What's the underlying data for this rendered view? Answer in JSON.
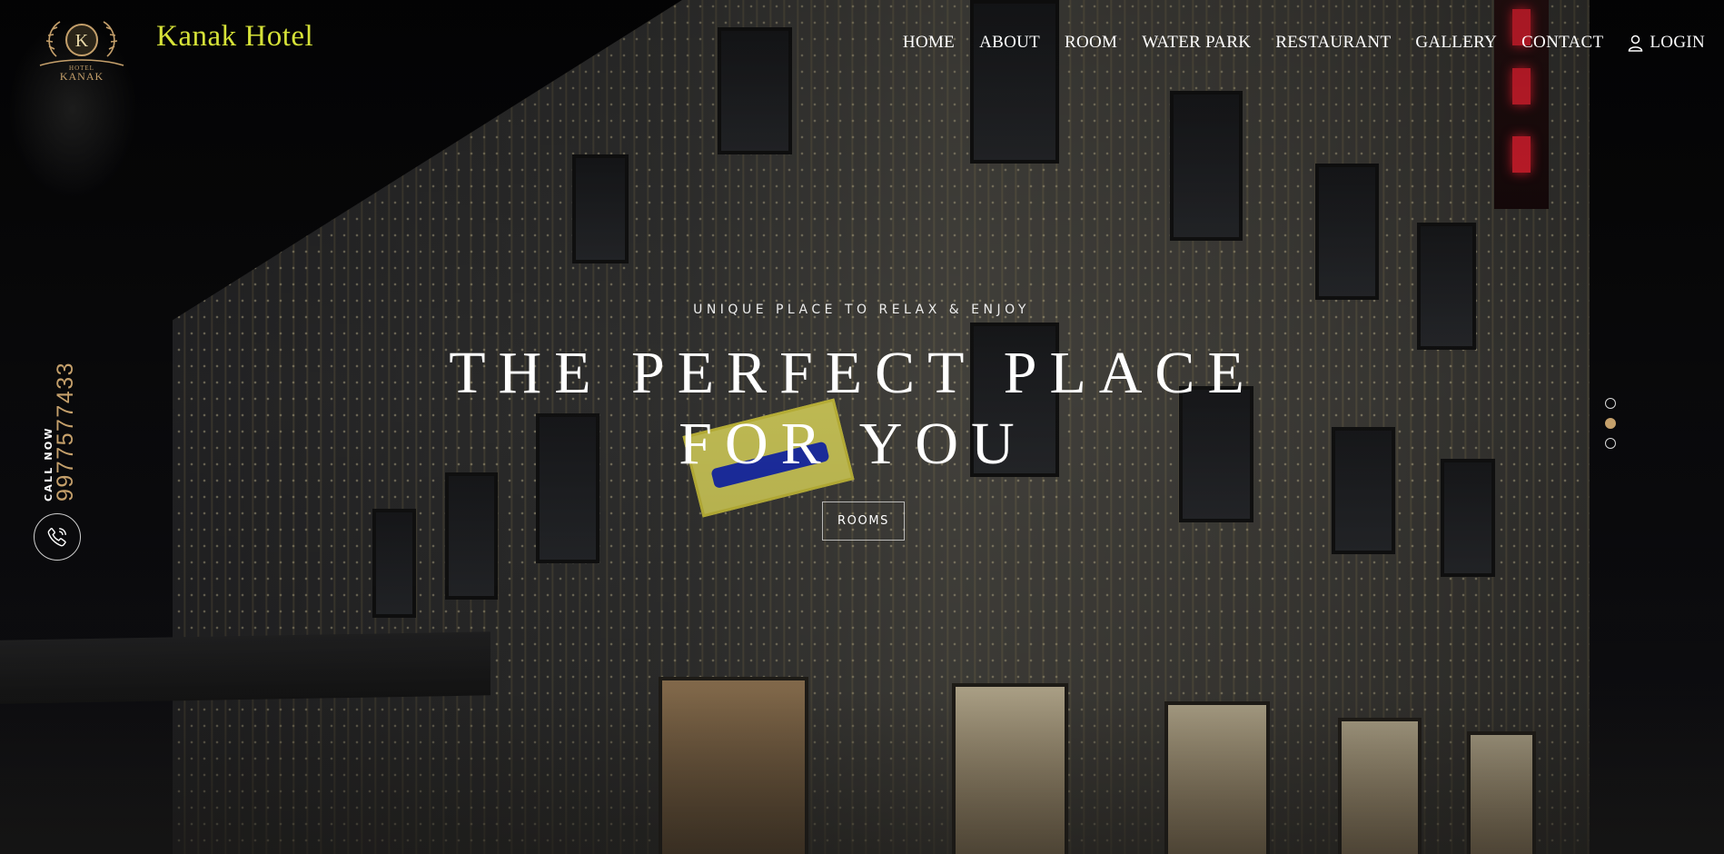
{
  "header": {
    "brand_name": "Kanak Hotel",
    "logo": {
      "letter": "K",
      "text_top": "HOTEL",
      "text_bottom": "KANAK"
    }
  },
  "nav": {
    "items": [
      {
        "label": "HOME"
      },
      {
        "label": "ABOUT"
      },
      {
        "label": "ROOM"
      },
      {
        "label": "WATER PARK"
      },
      {
        "label": "RESTAURANT"
      },
      {
        "label": "GALLERY"
      },
      {
        "label": "CONTACT"
      },
      {
        "label": "LOGIN",
        "icon": "user-icon"
      }
    ]
  },
  "hero": {
    "eyebrow": "UNIQUE PLACE TO RELAX & ENJOY",
    "headline_line1": "THE PERFECT PLACE",
    "headline_line2": "FOR YOU",
    "button_label": "ROOMS",
    "slides": {
      "count": 3,
      "active_index": 1
    }
  },
  "call": {
    "label": "CALL NOW",
    "number": "9977577433",
    "icon": "phone-icon"
  },
  "colors": {
    "brand": "#d6e238",
    "accent_gold": "#c5a06b",
    "text": "#ffffff"
  }
}
